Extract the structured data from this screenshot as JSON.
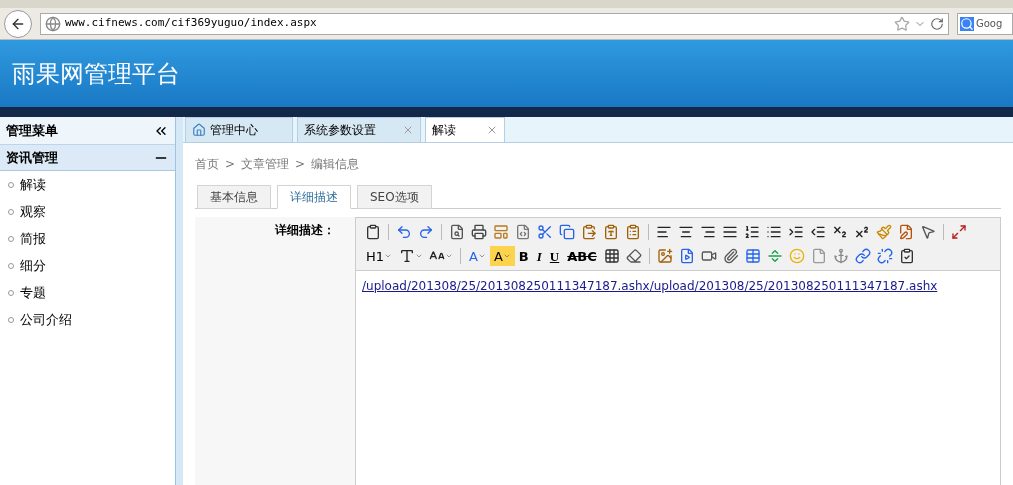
{
  "browser": {
    "url": "www.cifnews.com/cif369yuguo/index.aspx",
    "search_placeholder": "Goog"
  },
  "header": {
    "title": "雨果网管理平台"
  },
  "sidebar": {
    "title": "管理菜单",
    "section": {
      "title": "资讯管理",
      "expanded": true,
      "items": [
        {
          "label": "解读"
        },
        {
          "label": "观察"
        },
        {
          "label": "简报"
        },
        {
          "label": "细分"
        },
        {
          "label": "专题"
        },
        {
          "label": "公司介绍"
        }
      ]
    }
  },
  "tabs": [
    {
      "label": "管理中心",
      "kind": "home",
      "selected": false
    },
    {
      "label": "系统参数设置",
      "kind": "closable",
      "selected": false
    },
    {
      "label": "解读",
      "kind": "closable",
      "selected": true
    }
  ],
  "breadcrumb": {
    "separator": ">",
    "items": [
      "首页",
      "文章管理",
      "编辑信息"
    ]
  },
  "form_tabs": [
    {
      "label": "基本信息",
      "selected": false
    },
    {
      "label": "详细描述",
      "selected": true
    },
    {
      "label": "SEO选项",
      "selected": false
    }
  ],
  "field": {
    "label": "详细描述：",
    "content": "/upload/201308/25/201308250111347187.ashx/upload/201308/25/201308250111347187.ashx"
  },
  "toolbar": [
    [
      {
        "kind": "icon"
      },
      {
        "kind": "sep"
      },
      {
        "kind": "icon"
      },
      {
        "kind": "icon"
      },
      {
        "kind": "sep"
      },
      {
        "kind": "icon"
      },
      {
        "kind": "icon"
      },
      {
        "kind": "icon"
      },
      {
        "kind": "icon"
      },
      {
        "kind": "icon"
      },
      {
        "kind": "icon"
      },
      {
        "kind": "icon"
      },
      {
        "kind": "icon"
      },
      {
        "kind": "icon"
      },
      {
        "kind": "sep"
      },
      {
        "kind": "icon"
      },
      {
        "kind": "icon"
      },
      {
        "kind": "icon"
      },
      {
        "kind": "icon"
      },
      {
        "kind": "icon"
      },
      {
        "kind": "icon"
      },
      {
        "kind": "icon"
      },
      {
        "kind": "icon"
      },
      {
        "kind": "icon"
      },
      {
        "kind": "icon"
      },
      {
        "kind": "icon"
      },
      {
        "kind": "icon"
      },
      {
        "kind": "icon"
      },
      {
        "kind": "sep"
      },
      {
        "kind": "icon"
      }
    ],
    [
      {
        "kind": "text",
        "label": "H1"
      },
      {
        "kind": "icon"
      },
      {
        "kind": "icon"
      },
      {
        "kind": "sep"
      },
      {
        "kind": "text",
        "label": "A"
      },
      {
        "kind": "text",
        "label": "A"
      },
      {
        "kind": "text",
        "label": "B"
      },
      {
        "kind": "text",
        "label": "I"
      },
      {
        "kind": "text",
        "label": "U"
      },
      {
        "kind": "text",
        "label": "ABC"
      },
      {
        "kind": "icon"
      },
      {
        "kind": "icon"
      },
      {
        "kind": "sep"
      },
      {
        "kind": "icon"
      },
      {
        "kind": "icon"
      },
      {
        "kind": "icon"
      },
      {
        "kind": "icon"
      },
      {
        "kind": "icon"
      },
      {
        "kind": "icon"
      },
      {
        "kind": "icon"
      },
      {
        "kind": "icon"
      },
      {
        "kind": "icon"
      },
      {
        "kind": "icon"
      },
      {
        "kind": "icon"
      },
      {
        "kind": "icon"
      }
    ]
  ]
}
